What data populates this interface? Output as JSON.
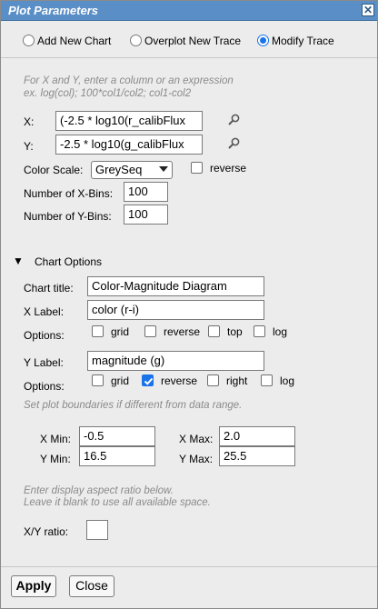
{
  "dialog": {
    "title": "Plot Parameters",
    "close_glyph": "✕"
  },
  "mode": {
    "options": [
      {
        "label": "Add New Chart",
        "checked": false
      },
      {
        "label": "Overplot New Trace",
        "checked": false
      },
      {
        "label": "Modify Trace",
        "checked": true
      }
    ]
  },
  "trace": {
    "hint_line1": "For X and Y, enter a column or an expression",
    "hint_line2": "ex. log(col); 100*col1/col2; col1-col2",
    "x_label": "X:",
    "x_value": "(-2.5 * log10(r_calibFlux",
    "y_label": "Y:",
    "y_value": "-2.5 * log10(g_calibFlux",
    "color_scale_label": "Color Scale:",
    "color_scale_value": "GreySeq",
    "reverse_label": "reverse",
    "reverse_checked": false,
    "xbins_label": "Number of X-Bins:",
    "xbins_value": "100",
    "ybins_label": "Number of Y-Bins:",
    "ybins_value": "100"
  },
  "chart_options": {
    "section_toggle": "▼",
    "section_label": "Chart Options",
    "title_label": "Chart title:",
    "title_value": "Color-Magnitude Diagram",
    "xlabel_label": "X Label:",
    "xlabel_value": "color (r-i)",
    "x_options_label": "Options:",
    "x_options": [
      {
        "label": "grid",
        "checked": false
      },
      {
        "label": "reverse",
        "checked": false
      },
      {
        "label": "top",
        "checked": false
      },
      {
        "label": "log",
        "checked": false
      }
    ],
    "ylabel_label": "Y Label:",
    "ylabel_value": "magnitude (g)",
    "y_options_label": "Options:",
    "y_options": [
      {
        "label": "grid",
        "checked": false
      },
      {
        "label": "reverse",
        "checked": true
      },
      {
        "label": "right",
        "checked": false
      },
      {
        "label": "log",
        "checked": false
      }
    ],
    "bounds_hint": "Set plot boundaries if different from data range.",
    "xmin_label": "X Min:",
    "xmin_value": "-0.5",
    "xmax_label": "X Max:",
    "xmax_value": "2.0",
    "ymin_label": "Y Min:",
    "ymin_value": "16.5",
    "ymax_label": "Y Max:",
    "ymax_value": "25.5",
    "ratio_hint1": "Enter display aspect ratio below.",
    "ratio_hint2": "Leave it blank to use all available space.",
    "ratio_label": "X/Y ratio:",
    "ratio_value": ""
  },
  "footer": {
    "apply_label": "Apply",
    "close_label": "Close"
  }
}
